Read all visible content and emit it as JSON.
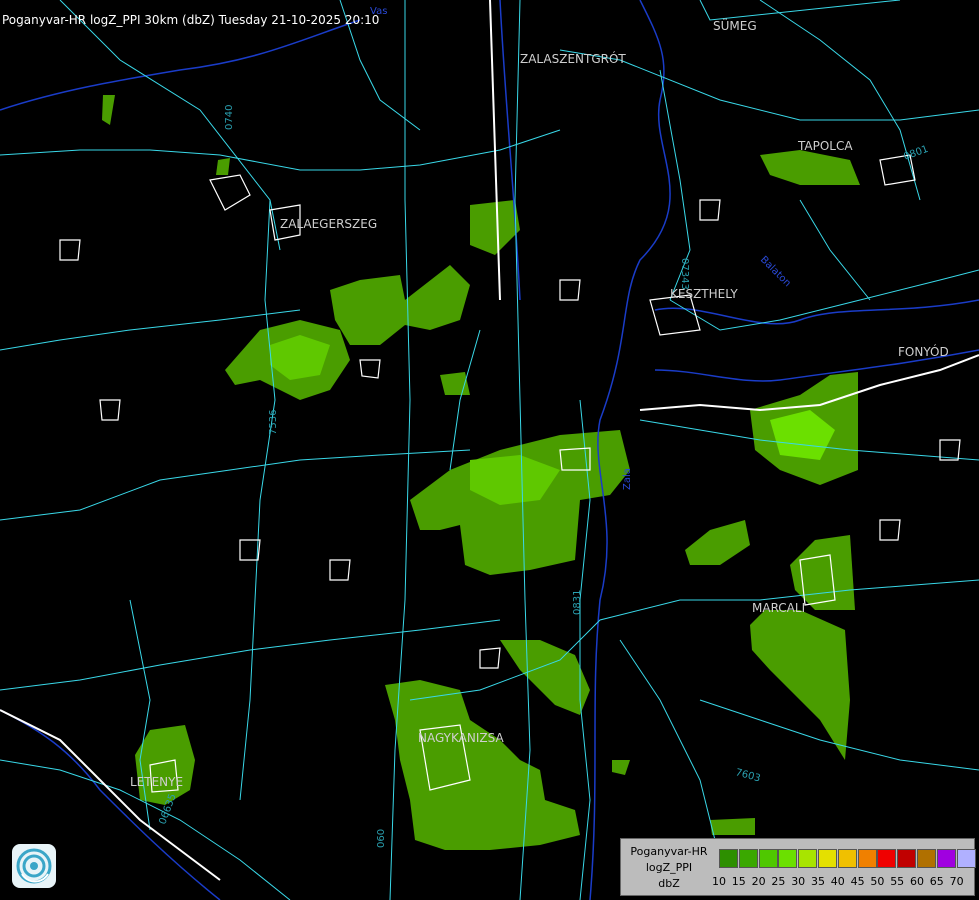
{
  "title": "Poganyvar-HR logZ_PPI 30km (dbZ) Tuesday 21-10-2025 20:10",
  "towns": [
    {
      "name": "SÜMEG"
    },
    {
      "name": "ZALASZENTGRÓT"
    },
    {
      "name": "TAPOLCA"
    },
    {
      "name": "ZALAEGERSZEG"
    },
    {
      "name": "KESZTHELY"
    },
    {
      "name": "FONYÓD"
    },
    {
      "name": "MARCALI"
    },
    {
      "name": "NAGYKANIZSA"
    },
    {
      "name": "LETENYE"
    }
  ],
  "road_labels": [
    "0740",
    "07343",
    "7536",
    "0831",
    "06635",
    "7603",
    "0801",
    "060"
  ],
  "water_labels": [
    "Zala",
    "Vas",
    "Balaton"
  ],
  "legend": {
    "line1": "Poganyvar-HR",
    "line2": "logZ_PPI",
    "line3": "dbZ",
    "colors": [
      "#2d8f00",
      "#3aa800",
      "#4fc800",
      "#6be000",
      "#a8e400",
      "#e4e000",
      "#f0c000",
      "#f08000",
      "#f00000",
      "#c00000",
      "#b07000",
      "#a000e0",
      "#b0b0ff"
    ],
    "ticks": [
      "10",
      "15",
      "20",
      "25",
      "30",
      "35",
      "40",
      "45",
      "50",
      "55",
      "60",
      "65",
      "70"
    ]
  }
}
